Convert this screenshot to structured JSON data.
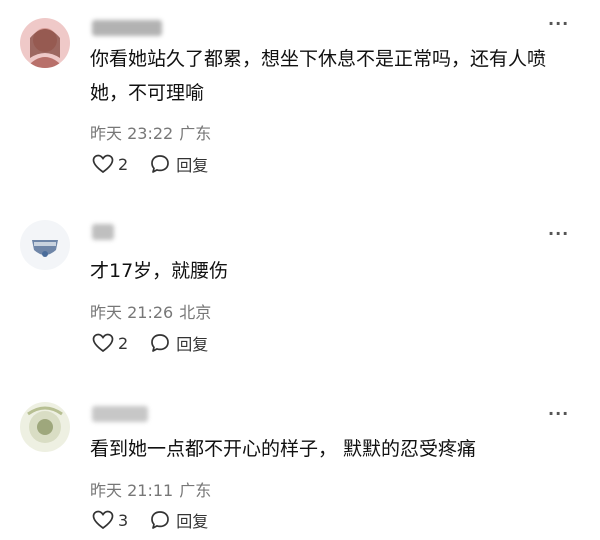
{
  "comments": [
    {
      "text": "你看她站久了都累，想坐下休息不是正常吗，还有人喷她，不可理喻",
      "time": "昨天 23:22",
      "location": "广东",
      "likes": "2",
      "reply_label": "回复",
      "more": "···",
      "username_blurred": true,
      "avatar_colors": [
        "#e9b7b8",
        "#8a4b3d"
      ]
    },
    {
      "text": "才17岁，就腰伤",
      "time": "昨天 21:26",
      "location": "北京",
      "likes": "2",
      "reply_label": "回复",
      "more": "···",
      "username_blurred": true,
      "avatar_colors": [
        "#c9d3df",
        "#4a6c9a"
      ]
    },
    {
      "text": "看到她一点都不开心的样子， 默默的忍受疼痛",
      "time": "昨天 21:11",
      "location": "广东",
      "likes": "3",
      "reply_label": "回复",
      "more": "···",
      "username_blurred": true,
      "avatar_colors": [
        "#d9ddc4",
        "#8f9a6a"
      ]
    }
  ]
}
